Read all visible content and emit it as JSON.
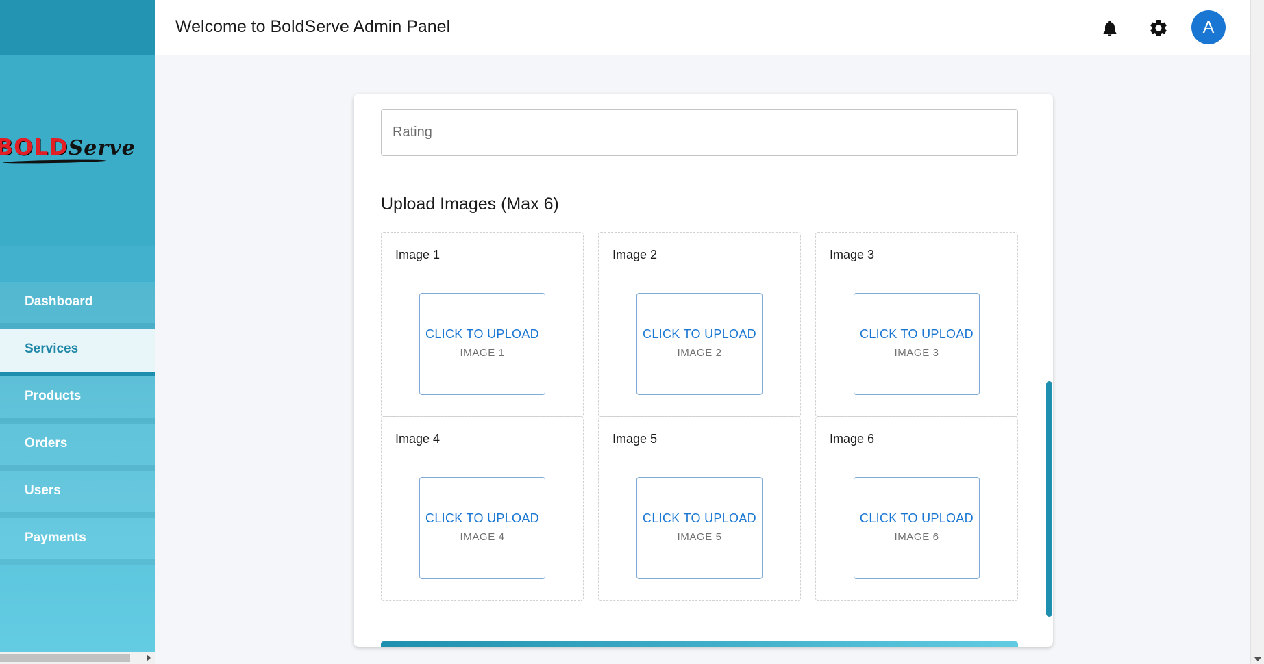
{
  "sidebar": {
    "logo_bold": "BOLD",
    "logo_serve": "Serve",
    "items": [
      {
        "label": "Dashboard",
        "active": false
      },
      {
        "label": "Services",
        "active": true
      },
      {
        "label": "Products",
        "active": false
      },
      {
        "label": "Orders",
        "active": false
      },
      {
        "label": "Users",
        "active": false
      },
      {
        "label": "Payments",
        "active": false
      }
    ]
  },
  "header": {
    "title": "Welcome to BoldServe Admin Panel",
    "notification_icon": "bell-icon",
    "settings_icon": "gear-icon",
    "avatar_initial": "A"
  },
  "form": {
    "rating_placeholder": "Rating",
    "rating_value": "",
    "upload_title": "Upload Images (Max 6)",
    "upload_slots": [
      {
        "label": "Image 1",
        "button_primary": "CLICK TO UPLOAD",
        "button_secondary": "IMAGE 1"
      },
      {
        "label": "Image 2",
        "button_primary": "CLICK TO UPLOAD",
        "button_secondary": "IMAGE 2"
      },
      {
        "label": "Image 3",
        "button_primary": "CLICK TO UPLOAD",
        "button_secondary": "IMAGE 3"
      },
      {
        "label": "Image 4",
        "button_primary": "CLICK TO UPLOAD",
        "button_secondary": "IMAGE 4"
      },
      {
        "label": "Image 5",
        "button_primary": "CLICK TO UPLOAD",
        "button_secondary": "IMAGE 5"
      },
      {
        "label": "Image 6",
        "button_primary": "CLICK TO UPLOAD",
        "button_secondary": "IMAGE 6"
      }
    ]
  },
  "colors": {
    "accent": "#1976d2",
    "sidebar_teal": "#2493b3",
    "active_text": "#1f87a8"
  }
}
